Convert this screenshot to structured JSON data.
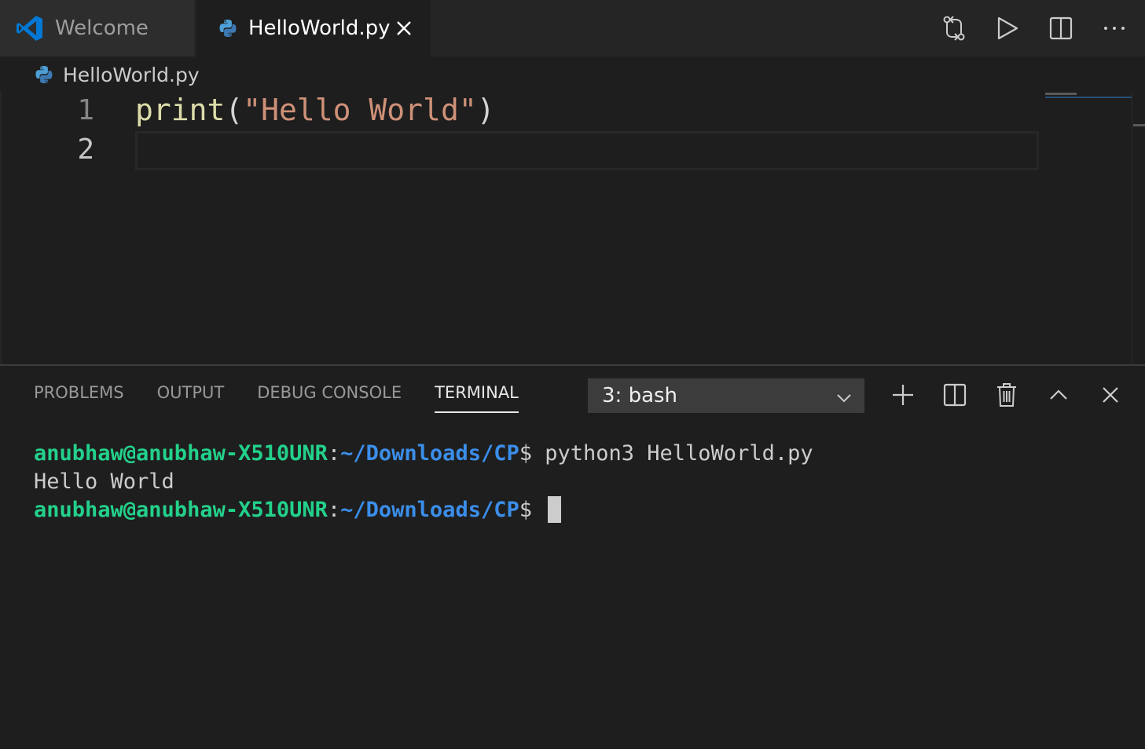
{
  "tabs": [
    {
      "label": "Welcome",
      "active": false
    },
    {
      "label": "HelloWorld.py",
      "active": true
    }
  ],
  "toolbar": {
    "icons": [
      "source-control-compare-icon",
      "run-icon",
      "split-editor-icon",
      "more-actions-icon"
    ]
  },
  "breadcrumb": {
    "file": "HelloWorld.py"
  },
  "editor": {
    "line_numbers": [
      "1",
      "2"
    ],
    "line1": {
      "fn": "print",
      "open": "(",
      "string": "\"Hello World\"",
      "close": ")"
    }
  },
  "panel": {
    "tabs": [
      "PROBLEMS",
      "OUTPUT",
      "DEBUG CONSOLE",
      "TERMINAL"
    ],
    "active_tab": "TERMINAL",
    "terminal_select": "3: bash"
  },
  "terminal": {
    "line1": {
      "user": "anubhaw@anubhaw-X510UNR",
      "colon": ":",
      "path": "~/Downloads/CP",
      "prompt": "$ ",
      "command": "python3 HelloWorld.py"
    },
    "line2": {
      "output": "Hello World"
    },
    "line3": {
      "user": "anubhaw@anubhaw-X510UNR",
      "colon": ":",
      "path": "~/Downloads/CP",
      "prompt": "$ "
    }
  },
  "colors": {
    "vscode_blue": "#0078d4",
    "python_blue": "#3d7ab3",
    "python_yellow": "#4d9fd6",
    "user_green": "#23d18b",
    "path_blue": "#3b8eea",
    "string": "#ce9178",
    "function": "#dcdcaa"
  }
}
